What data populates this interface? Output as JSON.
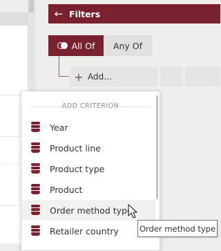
{
  "colors": {
    "accent": "#7a2130",
    "panel": "#e1e0de"
  },
  "filters": {
    "back_icon": "arrow-left-icon",
    "title": "Filters",
    "mode": {
      "all_label": "All Of",
      "any_label": "Any Of",
      "selected": "all"
    },
    "add_label": "Add..."
  },
  "menu": {
    "heading": "ADD CRITERION",
    "items": [
      {
        "label": "Year",
        "icon": "database-icon"
      },
      {
        "label": "Product line",
        "icon": "database-icon"
      },
      {
        "label": "Product type",
        "icon": "database-icon"
      },
      {
        "label": "Product",
        "icon": "database-icon"
      },
      {
        "label": "Order method type",
        "icon": "database-icon",
        "hovered": true
      },
      {
        "label": "Retailer country",
        "icon": "database-icon"
      }
    ]
  },
  "tooltip": {
    "text": "Order method type"
  }
}
